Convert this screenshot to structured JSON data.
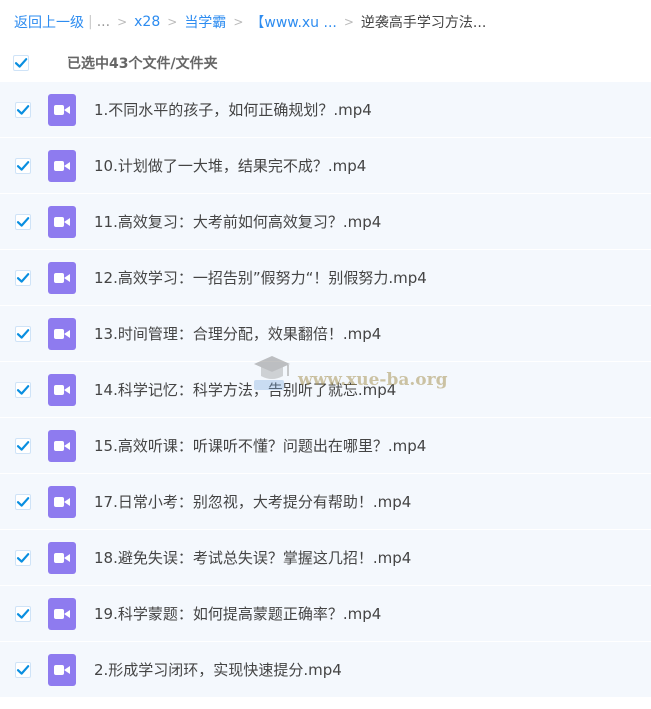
{
  "breadcrumb": {
    "back": "返回上一级",
    "ellipsis": "...",
    "items": [
      "x28",
      "当学霸",
      "【www.xu ..."
    ],
    "current": "逆袭高手学习方法..."
  },
  "selection": {
    "text": "已选中43个文件/文件夹",
    "checked": true
  },
  "files": [
    {
      "name": "1.不同水平的孩子，如何正确规划？.mp4",
      "checked": true
    },
    {
      "name": "10.计划做了一大堆，结果完不成？.mp4",
      "checked": true
    },
    {
      "name": "11.高效复习：大考前如何高效复习？.mp4",
      "checked": true
    },
    {
      "name": "12.高效学习：一招告别”假努力“！别假努力.mp4",
      "checked": true
    },
    {
      "name": "13.时间管理：合理分配，效果翻倍！.mp4",
      "checked": true
    },
    {
      "name": "14.科学记忆：科学方法，告别听了就忘.mp4",
      "checked": true
    },
    {
      "name": "15.高效听课：听课听不懂？问题出在哪里？.mp4",
      "checked": true
    },
    {
      "name": "17.日常小考：别忽视，大考提分有帮助！.mp4",
      "checked": true
    },
    {
      "name": "18.避免失误：考试总失误？掌握这几招！.mp4",
      "checked": true
    },
    {
      "name": "19.科学蒙题：如何提高蒙题正确率？.mp4",
      "checked": true
    },
    {
      "name": "2.形成学习闭环，实现快速提分.mp4",
      "checked": true
    }
  ],
  "watermark": "www.xue-ba.org",
  "colors": {
    "link": "#2d8cf0",
    "check": "#0a8fe0",
    "video_icon": "#8e7bef",
    "row_bg": "#f4f8fd"
  },
  "icons": {
    "checkbox": "checkmark-icon",
    "file": "video-file-icon",
    "watermark": "graduation-cap-icon"
  }
}
